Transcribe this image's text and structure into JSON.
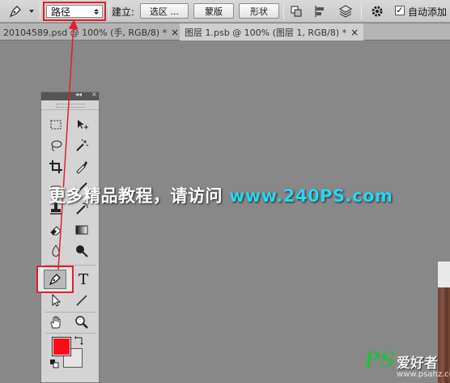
{
  "options_bar": {
    "mode_value": "路径",
    "make_label": "建立:",
    "selection_button": "选区 ...",
    "mask_button": "蒙版",
    "shape_button": "形状",
    "auto_add_label": "自动添加",
    "auto_add_checked": "✓"
  },
  "document_tabs": [
    {
      "label": "20104589.psd @ 100% (手, RGB/8) *",
      "close": "×"
    },
    {
      "label": "图层 1.psb @ 100% (图层 1, RGB/8) *",
      "close": "×"
    }
  ],
  "tool_panel": {
    "collapse_glyph": "◂◂",
    "close_glyph": "×",
    "type_tool_glyph": "T",
    "active_tool": "pen-tool"
  },
  "colors": {
    "foreground": "#ff0a17",
    "background": "#e5e5e5",
    "highlight_box": "#e0202a",
    "arrow": "#e0202a"
  },
  "watermark": {
    "text": "更多精品教程，请访问",
    "url": "www.240PS.com"
  },
  "logo": {
    "mark": "PS",
    "name": "爱好者",
    "site": "www.psahz.com"
  }
}
